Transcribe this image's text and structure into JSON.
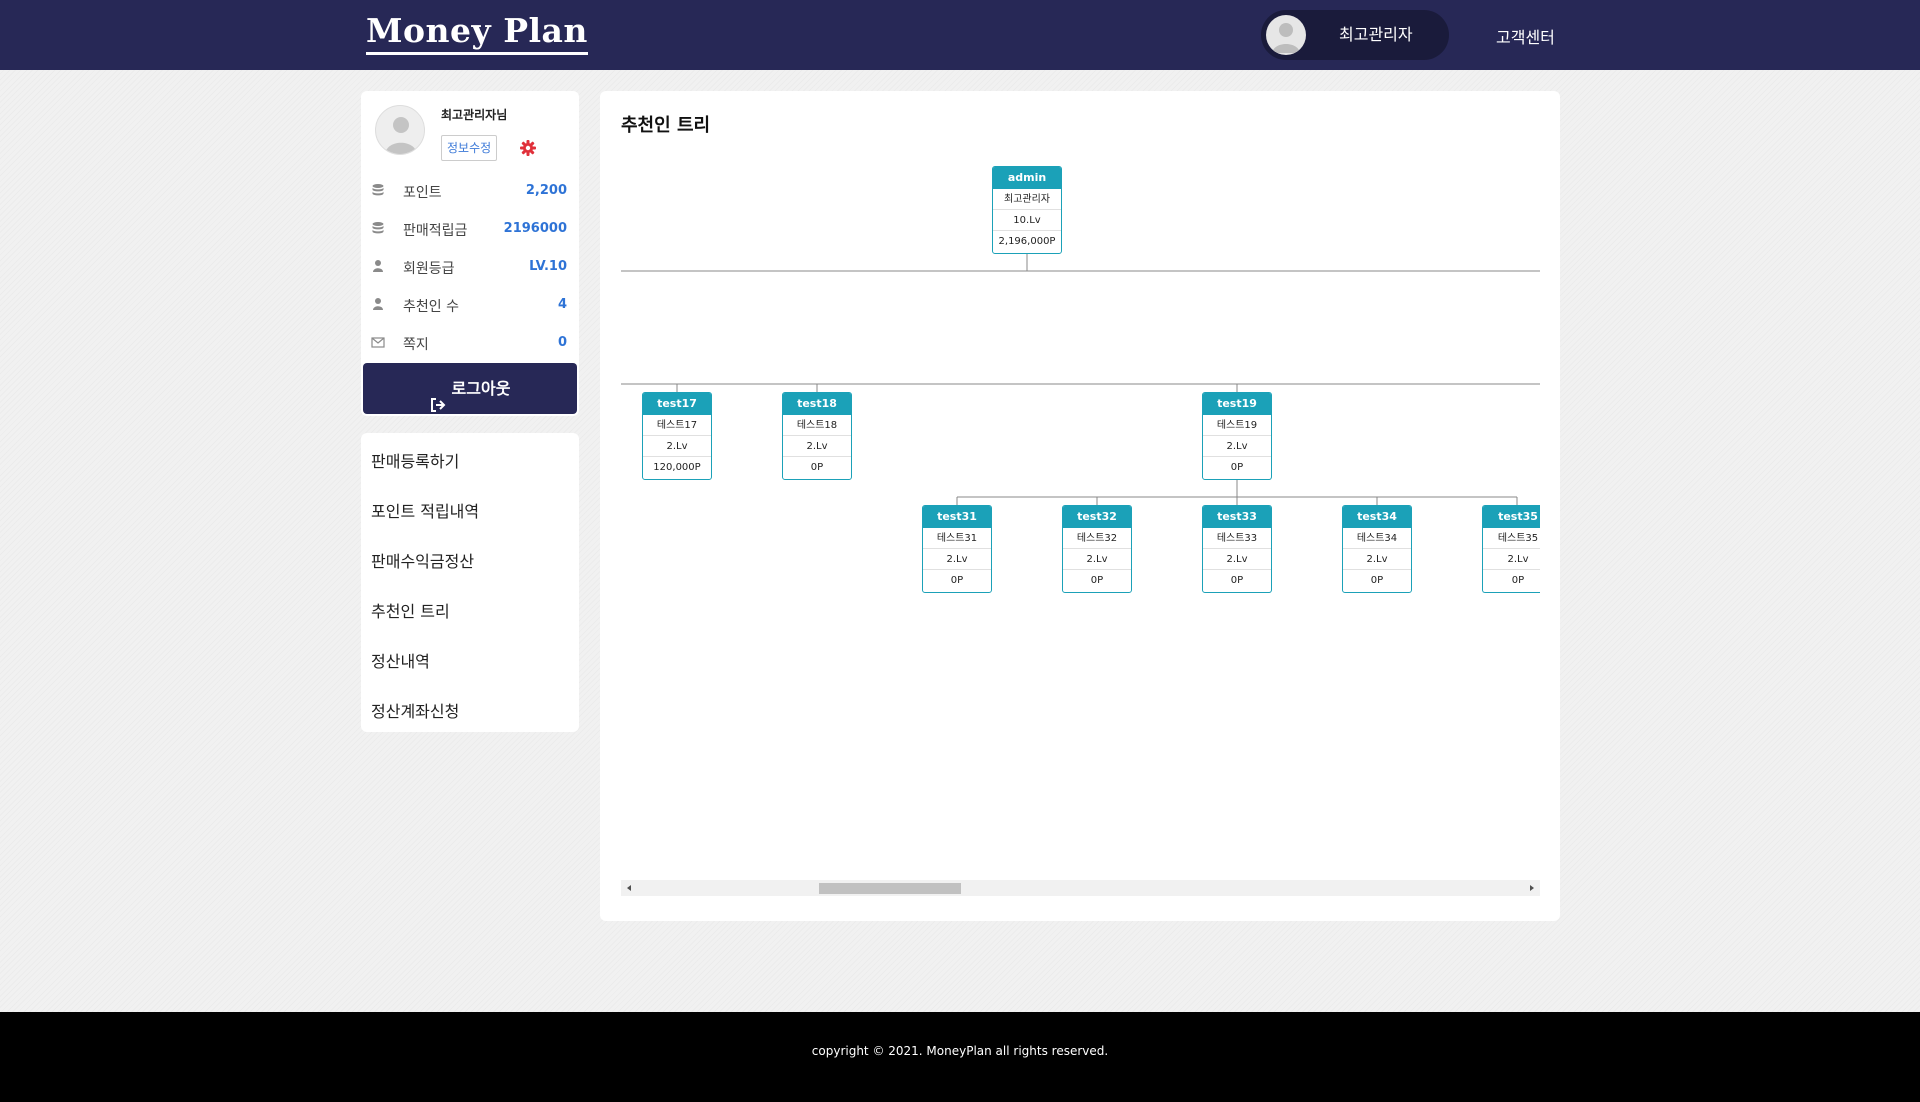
{
  "header": {
    "logo": "Money Plan",
    "user_name": "최고관리자",
    "cs_link": "고객센터"
  },
  "profile": {
    "name": "최고관리자님",
    "edit_button": "정보수정",
    "stats": [
      {
        "label": "포인트",
        "value": "2,200",
        "icon": "database-icon"
      },
      {
        "label": "판매적립금",
        "value": "2196000",
        "icon": "database-icon"
      },
      {
        "label": "회원등급",
        "value": "LV.10",
        "icon": "user-icon"
      },
      {
        "label": "추천인 수",
        "value": "4",
        "icon": "user-icon"
      },
      {
        "label": "쪽지",
        "value": "0",
        "icon": "envelope-icon"
      }
    ],
    "logout": "로그아웃"
  },
  "menu": {
    "items": [
      {
        "label": "판매등록하기"
      },
      {
        "label": "포인트 적립내역"
      },
      {
        "label": "판매수익금정산"
      },
      {
        "label": "추천인 트리"
      },
      {
        "label": "정산내역"
      },
      {
        "label": "정산계좌신청"
      }
    ]
  },
  "main": {
    "title": "추천인 트리"
  },
  "tree": {
    "root": {
      "id": "admin",
      "name": "최고관리자",
      "level": "10.Lv",
      "points": "2,196,000P"
    },
    "level1": [
      {
        "id": "test17",
        "name": "테스트17",
        "level": "2.Lv",
        "points": "120,000P"
      },
      {
        "id": "test18",
        "name": "테스트18",
        "level": "2.Lv",
        "points": "0P"
      },
      {
        "id": "test19",
        "name": "테스트19",
        "level": "2.Lv",
        "points": "0P"
      }
    ],
    "level2": [
      {
        "id": "test31",
        "name": "테스트31",
        "level": "2.Lv",
        "points": "0P"
      },
      {
        "id": "test32",
        "name": "테스트32",
        "level": "2.Lv",
        "points": "0P"
      },
      {
        "id": "test33",
        "name": "테스트33",
        "level": "2.Lv",
        "points": "0P"
      },
      {
        "id": "test34",
        "name": "테스트34",
        "level": "2.Lv",
        "points": "0P"
      },
      {
        "id": "test35",
        "name": "테스트35",
        "level": "2.Lv",
        "points": "0P"
      }
    ]
  },
  "footer": {
    "copyright": "copyright © 2021. MoneyPlan all rights reserved."
  },
  "colors": {
    "navy": "#272856",
    "teal": "#1ba1b8",
    "accent_blue": "#2e73d6"
  }
}
